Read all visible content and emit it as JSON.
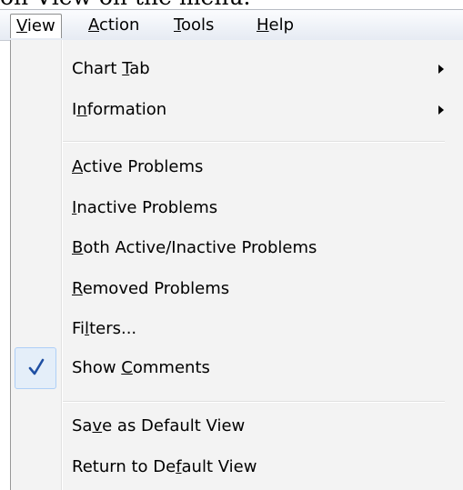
{
  "caption": "on View on the menu.",
  "menubar": {
    "view": {
      "prefix": "",
      "key": "V",
      "suffix": "iew"
    },
    "action": {
      "prefix": "",
      "key": "A",
      "suffix": "ction"
    },
    "tools": {
      "prefix": "",
      "key": "T",
      "suffix": "ools"
    },
    "help": {
      "prefix": "",
      "key": "H",
      "suffix": "elp"
    }
  },
  "menu": {
    "chart_tab": {
      "prefix": "Chart ",
      "key": "T",
      "suffix": "ab",
      "has_submenu": true
    },
    "information": {
      "prefix": "I",
      "key": "n",
      "suffix": "formation",
      "has_submenu": true
    },
    "active_problems": {
      "prefix": "",
      "key": "A",
      "suffix": "ctive Problems"
    },
    "inactive_problems": {
      "prefix": "",
      "key": "I",
      "suffix": "nactive Problems"
    },
    "both_problems": {
      "prefix": "",
      "key": "B",
      "suffix": "oth Active/Inactive Problems"
    },
    "removed_problems": {
      "prefix": "",
      "key": "R",
      "suffix": "emoved Problems"
    },
    "filters": {
      "prefix": "Fi",
      "key": "l",
      "suffix": "ters..."
    },
    "show_comments": {
      "prefix": "Show ",
      "key": "C",
      "suffix": "omments",
      "checked": true,
      "check_icon": "checkmark-icon"
    },
    "save_default": {
      "prefix": "Sa",
      "key": "v",
      "suffix": "e as Default View"
    },
    "return_default": {
      "prefix": "Return to De",
      "key": "f",
      "suffix": "ault View"
    }
  },
  "colors": {
    "checkmark": "#1f4fa3",
    "menu_background": "#f3f3f3",
    "check_highlight": "#e4eef9"
  }
}
